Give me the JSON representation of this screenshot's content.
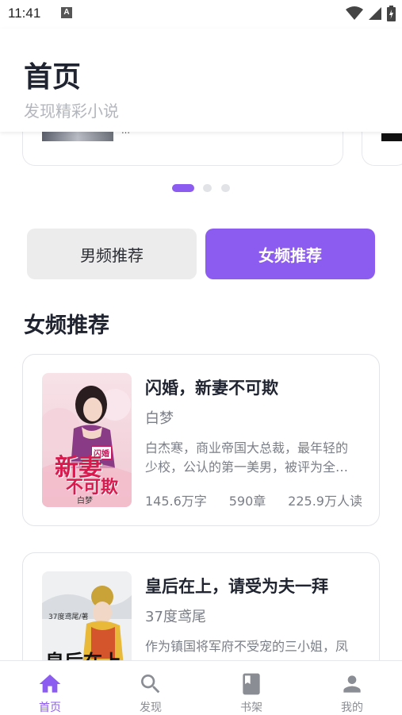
{
  "status_bar": {
    "time": "11:41",
    "notification_icon": "A"
  },
  "header": {
    "title": "首页",
    "subtitle": "发现精彩小说"
  },
  "banner": {
    "card1_text": "…"
  },
  "tabs": [
    {
      "label": "男频推荐",
      "selected": false
    },
    {
      "label": "女频推荐",
      "selected": true
    }
  ],
  "section": {
    "title": "女频推荐"
  },
  "books": [
    {
      "title": "闪婚，新妻不可欺",
      "author": "白梦",
      "desc_line1": "白杰寒，商业帝国大总裁，最年轻的",
      "desc_line2": "少校，公认的第一美男，被评为全…",
      "words": "145.6万字",
      "chapters": "590章",
      "readers": "225.9万人读",
      "cover_text_main": "新妻",
      "cover_text_sub": "不可欺",
      "cover_tag": "闪婚",
      "cover_author": "白梦"
    },
    {
      "title": "皇后在上，请受为夫一拜",
      "author": "37度鸢尾",
      "desc_line1": "作为镇国将军府不受宠的三小姐，凤",
      "cover_author": "37度鸢尾/著",
      "cover_text_main": "皇后在上"
    }
  ],
  "nav": [
    {
      "label": "首页",
      "icon": "home-icon",
      "active": true
    },
    {
      "label": "发现",
      "icon": "search-icon",
      "active": false
    },
    {
      "label": "书架",
      "icon": "bookshelf-icon",
      "active": false
    },
    {
      "label": "我的",
      "icon": "profile-icon",
      "active": false
    }
  ],
  "colors": {
    "accent": "#8c5cf0",
    "text": "#1f2430",
    "muted": "#7a7e87"
  }
}
